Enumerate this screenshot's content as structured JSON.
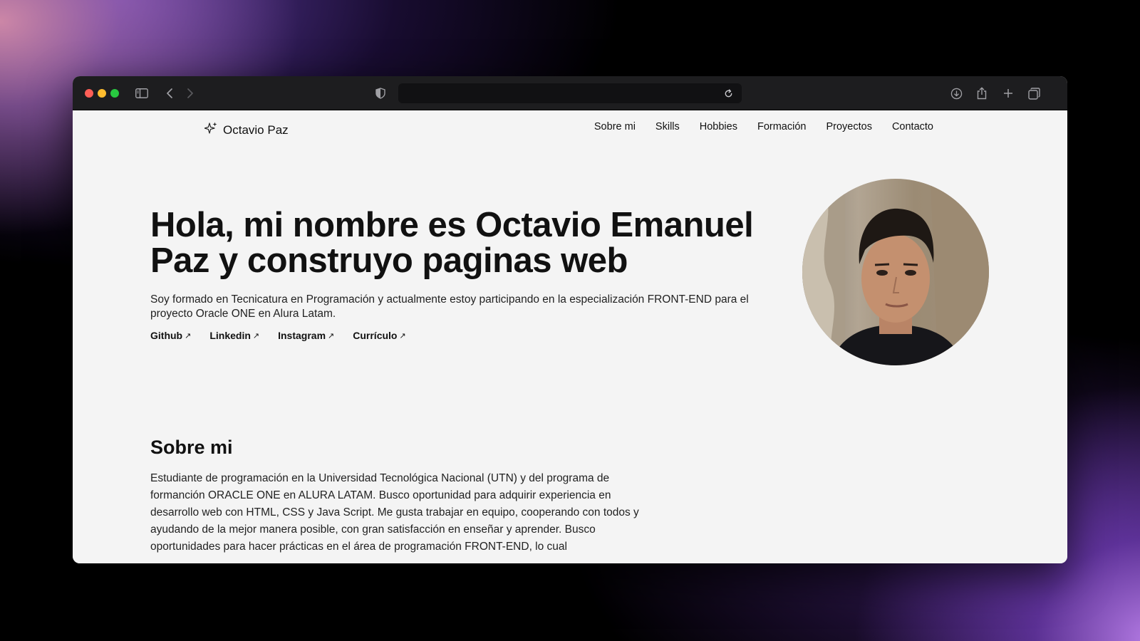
{
  "browser": {
    "url": "",
    "icons": [
      "sidebar-icon",
      "back-icon",
      "forward-icon",
      "shield-icon",
      "reload-icon",
      "download-icon",
      "share-icon",
      "new-tab-icon",
      "tabs-overview-icon"
    ]
  },
  "header": {
    "brand": "Octavio Paz",
    "nav": [
      "Sobre mi",
      "Skills",
      "Hobbies",
      "Formación",
      "Proyectos",
      "Contacto"
    ]
  },
  "hero": {
    "title": "Hola, mi nombre es Octavio Emanuel Paz y construyo paginas web",
    "description": "Soy formado en Tecnicatura en Programación y actualmente estoy participando en la especialización FRONT-END para el proyecto Oracle ONE en Alura Latam.",
    "links": [
      "Github",
      "Linkedin",
      "Instagram",
      "Currículo"
    ],
    "link_arrow": "↗"
  },
  "about": {
    "title": "Sobre mi",
    "text": "Estudiante de programación en la Universidad Tecnológica Nacional (UTN) y del programa de formanción ORACLE ONE en ALURA LATAM. Busco oportunidad para adquirir experiencia en desarrollo web con HTML, CSS y Java Script. Me gusta trabajar en equipo, cooperando con todos y ayudando de la mejor manera posible, con gran satisfacción en enseñar y aprender. Busco oportunidades para hacer prácticas en el área de programación FRONT-END, lo cual"
  },
  "colors": {
    "page_bg": "#f4f4f4",
    "toolbar_bg": "#1d1d1f",
    "text": "#111111"
  }
}
